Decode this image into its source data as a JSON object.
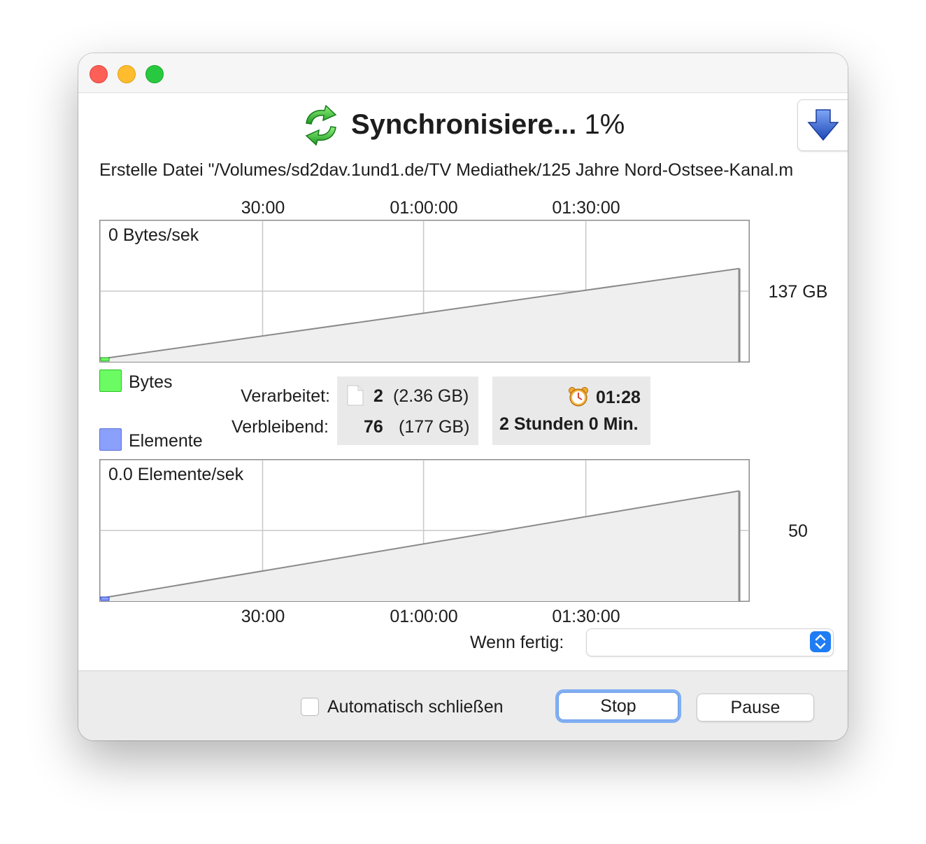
{
  "window": {
    "title": {
      "action": "Synchronisiere...",
      "percent": "1%"
    },
    "status_line": "Erstelle Datei \"/Volumes/sd2dav.1und1.de/TV Mediathek/125 Jahre Nord-Ostsee-Kanal.m"
  },
  "top_axis_ticks": [
    "30:00",
    "01:00:00",
    "01:30:00"
  ],
  "bottom_axis_ticks": [
    "30:00",
    "01:00:00",
    "01:30:00"
  ],
  "bytes_chart": {
    "rate_label": "0 Bytes/sek",
    "max_label": "137 GB"
  },
  "items_chart": {
    "rate_label": "0.0 Elemente/sek",
    "max_label": "50"
  },
  "legend": [
    {
      "label": "Bytes",
      "color": "#6bfb62"
    },
    {
      "label": "Elemente",
      "color": "#8aa0fb"
    }
  ],
  "stats": {
    "processed_label": "Verarbeitet:",
    "processed_count": "2",
    "processed_size": "(2.36 GB)",
    "remaining_label": "Verbleibend:",
    "remaining_count": "76",
    "remaining_size": "(177 GB)",
    "elapsed_time": "01:28",
    "remaining_time": "2 Stunden 0 Min."
  },
  "when_done": {
    "label": "Wenn fertig:",
    "value": ""
  },
  "footer": {
    "auto_close_label": "Automatisch schließen",
    "auto_close_checked": false,
    "stop_label": "Stop",
    "pause_label": "Pause"
  },
  "icons": {
    "sync": "sync-arrows-icon",
    "download": "download-arrow-icon",
    "document": "document-icon",
    "alarm": "alarm-clock-icon",
    "select_arrows": "chevron-updown-icon"
  },
  "colors": {
    "bytes_series": "#6bfb62",
    "items_series": "#8aa0fb",
    "accent": "#1f7cf3"
  },
  "chart_data": [
    {
      "type": "area",
      "x_ticks": [
        "30:00",
        "01:00:00",
        "01:30:00"
      ],
      "label": "0 Bytes/sek",
      "y_max_label": "137 GB",
      "series": [
        {
          "name": "Bytes",
          "x_fraction": [
            0,
            0.985
          ],
          "y_fraction": [
            0.02,
            0.66
          ]
        }
      ]
    },
    {
      "type": "area",
      "x_ticks": [
        "30:00",
        "01:00:00",
        "01:30:00"
      ],
      "label": "0.0 Elemente/sek",
      "y_max_label": "50",
      "series": [
        {
          "name": "Elemente",
          "x_fraction": [
            0,
            0.985
          ],
          "y_fraction": [
            0.02,
            0.78
          ]
        }
      ]
    }
  ]
}
